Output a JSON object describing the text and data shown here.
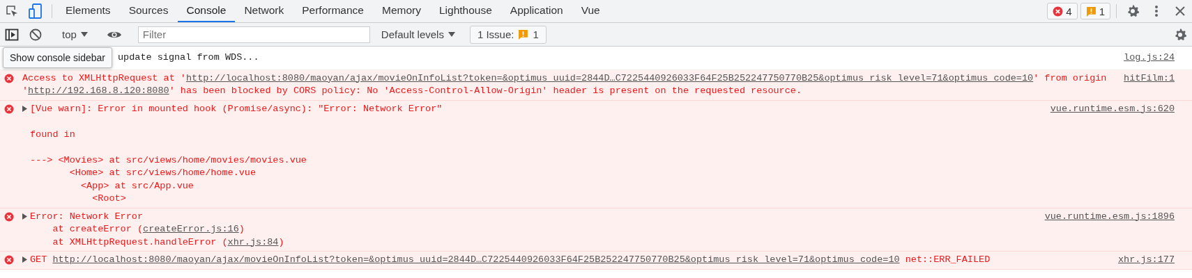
{
  "tabs": [
    {
      "label": "Elements",
      "selected": false
    },
    {
      "label": "Sources",
      "selected": false
    },
    {
      "label": "Console",
      "selected": true
    },
    {
      "label": "Network",
      "selected": false
    },
    {
      "label": "Performance",
      "selected": false
    },
    {
      "label": "Memory",
      "selected": false
    },
    {
      "label": "Lighthouse",
      "selected": false
    },
    {
      "label": "Application",
      "selected": false
    },
    {
      "label": "Vue",
      "selected": false
    }
  ],
  "counters": {
    "errors": "4",
    "warnings": "1"
  },
  "toolbar": {
    "context": "top",
    "filter_placeholder": "Filter",
    "levels": "Default levels",
    "issues_label": "1 Issue:",
    "issues_count": "1"
  },
  "tooltip": "Show console sidebar",
  "messages": [
    {
      "kind": "info",
      "expandable": false,
      "parts": [
        {
          "text": "update signal from WDS..."
        }
      ],
      "source": "log.js:24"
    },
    {
      "kind": "error",
      "expandable": false,
      "parts": [
        {
          "text": "Access to XMLHttpRequest at '"
        },
        {
          "link": "http://localhost:8080/maoyan/ajax/movieOnInfoList?token=&optimus_uuid=2844D…C7225440926033F64F25B252247750770B25&optimus_risk_level=71&optimus_code=10"
        },
        {
          "text": "' from origin '"
        },
        {
          "link": "http://192.168.8.120:8080"
        },
        {
          "text": "' has been blocked by CORS policy: No 'Access-Control-Allow-Origin' header is present on the requested resource."
        }
      ],
      "source": "hitFilm:1"
    },
    {
      "kind": "error",
      "expandable": true,
      "parts": [
        {
          "text": "[Vue warn]: Error in mounted hook (Promise/async): \"Error: Network Error\"\n\nfound in\n\n---> <Movies> at src/views/home/movies/movies.vue\n       <Home> at src/views/home/home.vue\n         <App> at src/App.vue\n           <Root>"
        }
      ],
      "source": "vue.runtime.esm.js:620"
    },
    {
      "kind": "error",
      "expandable": true,
      "parts": [
        {
          "text": "Error: Network Error\n    at createError ("
        },
        {
          "link": "createError.js:16"
        },
        {
          "text": ")\n    at XMLHttpRequest.handleError ("
        },
        {
          "link": "xhr.js:84"
        },
        {
          "text": ")"
        }
      ],
      "source": "vue.runtime.esm.js:1896"
    },
    {
      "kind": "error",
      "expandable": true,
      "parts": [
        {
          "text": "GET "
        },
        {
          "link": "http://localhost:8080/maoyan/ajax/movieOnInfoList?token=&optimus_uuid=2844D…C7225440926033F64F25B252247750770B25&optimus_risk_level=71&optimus_code=10"
        },
        {
          "text": " net::ERR_FAILED"
        }
      ],
      "source": "xhr.js:177"
    }
  ]
}
